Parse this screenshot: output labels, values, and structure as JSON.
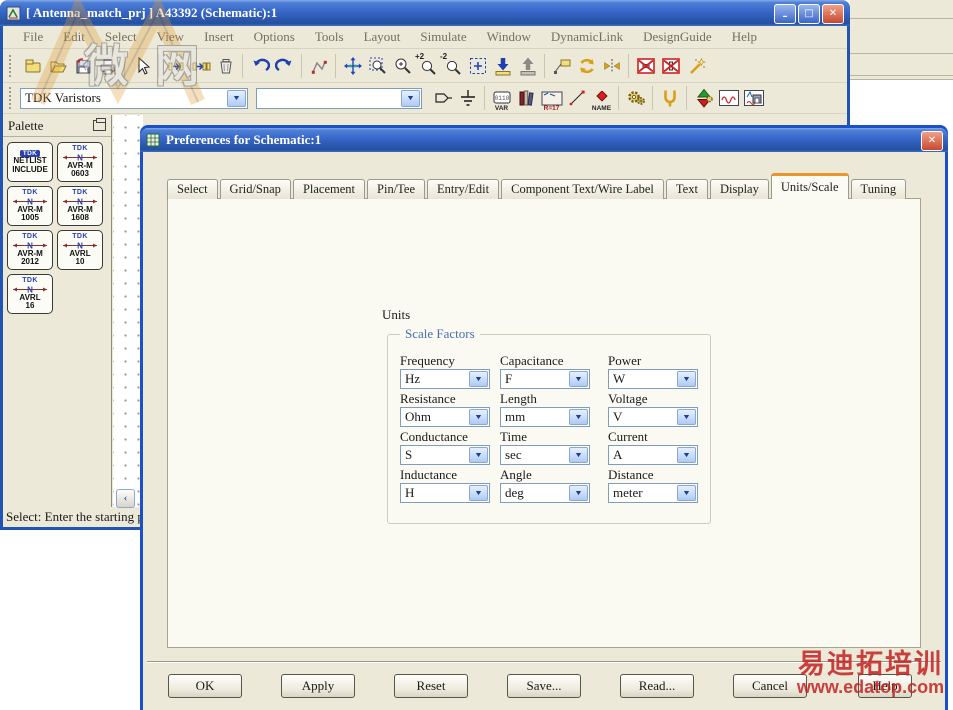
{
  "main_window": {
    "title": "[ Antenna_match_prj ] A43392 (Schematic):1",
    "menu_items": [
      "File",
      "Edit",
      "Select",
      "View",
      "Insert",
      "Options",
      "Tools",
      "Layout",
      "Simulate",
      "Window",
      "DynamicLink",
      "DesignGuide",
      "Help"
    ],
    "toolbar_icon_labels": {
      "zoom_in_2": "+2",
      "zoom_out_2": "-2",
      "var": "VAR",
      "display_template": "R=17",
      "wire_name": "NAME"
    },
    "toolbar2": {
      "palette_select_value": "TDK Varistors",
      "component_select_value": ""
    },
    "palette": {
      "title": "Palette",
      "items": [
        {
          "brand": "TDK",
          "line1": "NETLIST",
          "line2": "INCLUDE"
        },
        {
          "brand": "TDK",
          "line1": "AVR-M",
          "line2": "0603"
        },
        {
          "brand": "TDK",
          "line1": "AVR-M",
          "line2": "1005"
        },
        {
          "brand": "TDK",
          "line1": "AVR-M",
          "line2": "1608"
        },
        {
          "brand": "TDK",
          "line1": "AVR-M",
          "line2": "2012"
        },
        {
          "brand": "TDK",
          "line1": "AVRL",
          "line2": "10"
        },
        {
          "brand": "TDK",
          "line1": "AVRL",
          "line2": "16"
        }
      ]
    },
    "status_text": "Select: Enter the starting poi"
  },
  "dialog": {
    "title": "Preferences for Schematic:1",
    "tabs": [
      "Select",
      "Grid/Snap",
      "Placement",
      "Pin/Tee",
      "Entry/Edit",
      "Component Text/Wire Label",
      "Text",
      "Display",
      "Units/Scale",
      "Tuning"
    ],
    "active_tab": "Units/Scale",
    "units_label": "Units",
    "group_label": "Scale Factors",
    "fields": [
      {
        "label": "Frequency",
        "value": "Hz"
      },
      {
        "label": "Capacitance",
        "value": "F"
      },
      {
        "label": "Power",
        "value": "W"
      },
      {
        "label": "Resistance",
        "value": "Ohm"
      },
      {
        "label": "Length",
        "value": "mm"
      },
      {
        "label": "Voltage",
        "value": "V"
      },
      {
        "label": "Conductance",
        "value": "S"
      },
      {
        "label": "Time",
        "value": "sec"
      },
      {
        "label": "Current",
        "value": "A"
      },
      {
        "label": "Inductance",
        "value": "H"
      },
      {
        "label": "Angle",
        "value": "deg"
      },
      {
        "label": "Distance",
        "value": "meter"
      }
    ],
    "buttons": [
      "OK",
      "Apply",
      "Reset",
      "Save...",
      "Read...",
      "Cancel",
      "Help"
    ]
  },
  "watermarks": {
    "top_left_chars": "微 网",
    "bottom_right_line1": "易迪拓培训",
    "bottom_right_line2": "www.edatop.com"
  },
  "colors": {
    "titlebar_blue": "#3766c8",
    "toolbar_beige": "#ece9d8",
    "active_tab_orange": "#e8962e",
    "group_label_blue": "#4a70ae",
    "watermark_red": "#c32222"
  }
}
